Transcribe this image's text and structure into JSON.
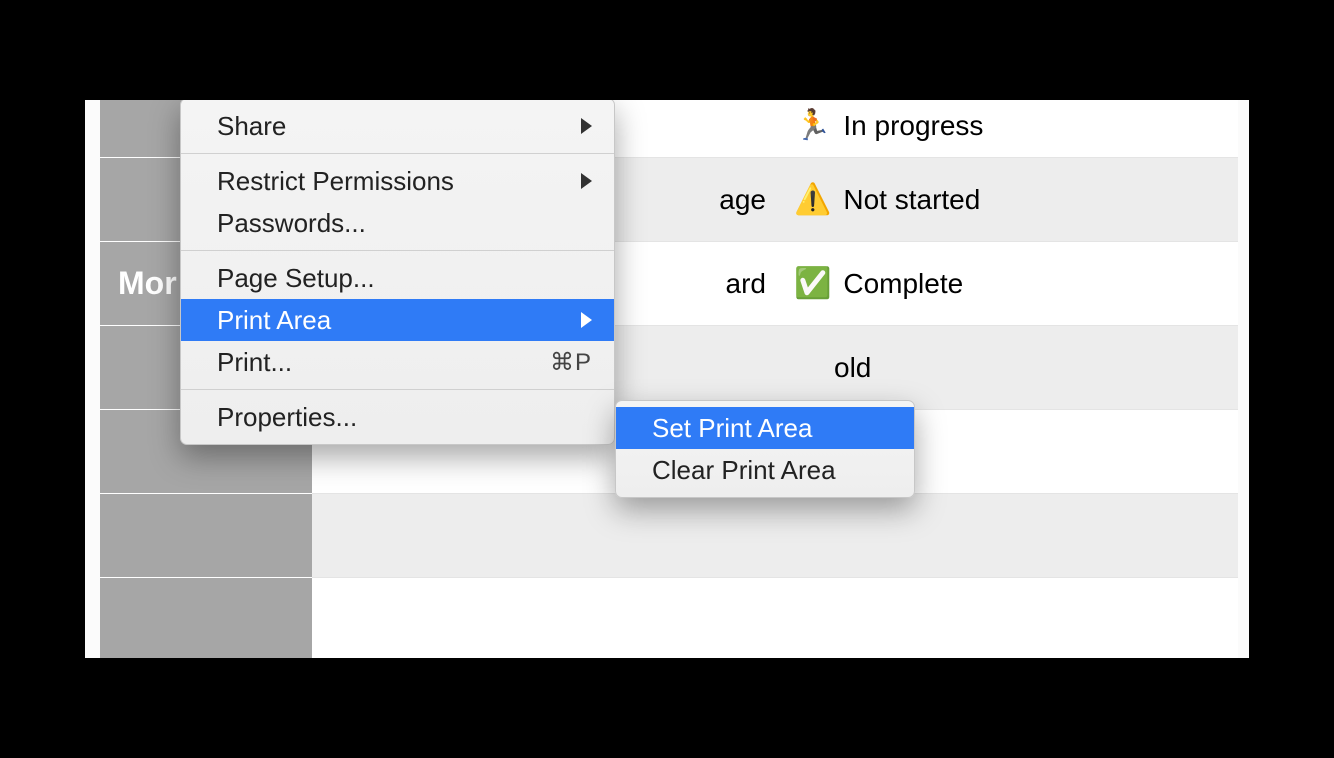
{
  "sheet": {
    "sidebar_label": "Mor",
    "rows": [
      {
        "b": "",
        "status_icon": "🏃",
        "status": "In progress"
      },
      {
        "b": "age",
        "status_icon": "⚠️",
        "status": "Not started"
      },
      {
        "b": "ard",
        "status_icon": "✅",
        "status": "Complete"
      },
      {
        "b": "",
        "status_icon": "",
        "status": "old"
      }
    ]
  },
  "menu": {
    "share": "Share",
    "restrict": "Restrict Permissions",
    "passwords": "Passwords...",
    "page_setup": "Page Setup...",
    "print_area": "Print Area",
    "print": "Print...",
    "print_shortcut": "⌘P",
    "properties": "Properties..."
  },
  "submenu": {
    "set": "Set Print Area",
    "clear": "Clear Print Area"
  }
}
